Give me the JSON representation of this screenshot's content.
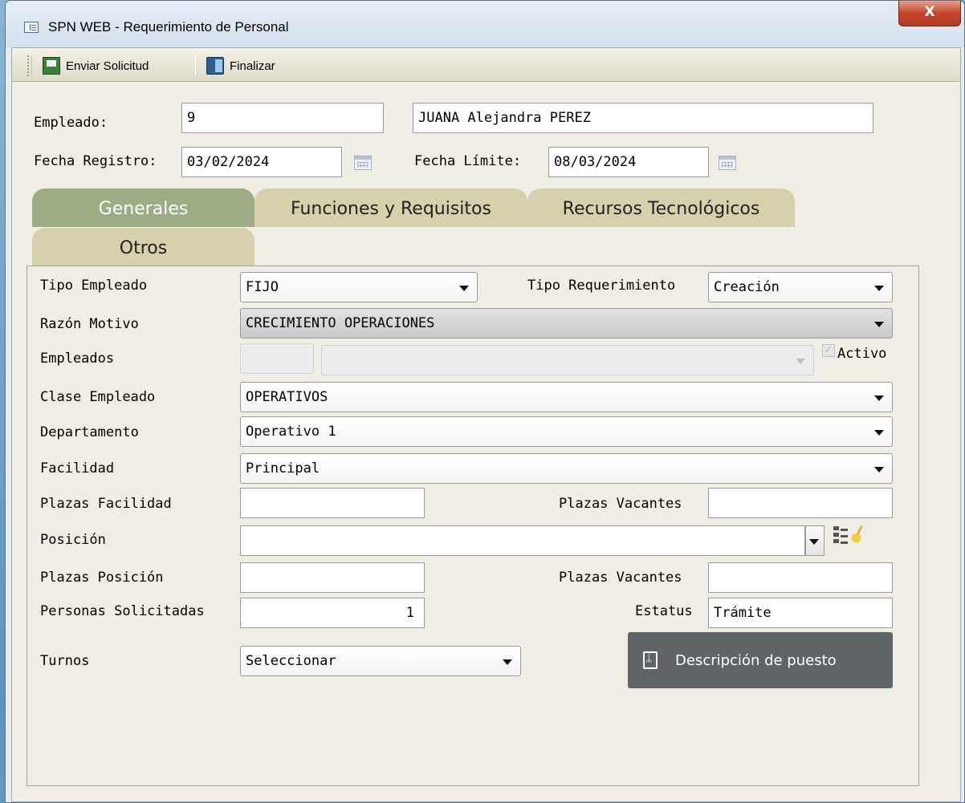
{
  "window": {
    "title": "SPN WEB - Requerimiento de Personal",
    "close_glyph": "X"
  },
  "toolbar": {
    "send_label": "Enviar Solicitud",
    "finish_label": "Finalizar"
  },
  "header": {
    "empleado_label": "Empleado:",
    "empleado_id": "9",
    "empleado_name": "JUANA Alejandra PEREZ",
    "fecha_registro_label": "Fecha Registro:",
    "fecha_registro": "03/02/2024",
    "fecha_limite_label": "Fecha Límite:",
    "fecha_limite": "08/03/2024"
  },
  "tabs": [
    {
      "label": "Generales",
      "active": true
    },
    {
      "label": "Funciones y Requisitos",
      "active": false
    },
    {
      "label": "Recursos Tecnológicos",
      "active": false
    },
    {
      "label": "Otros",
      "active": false
    }
  ],
  "form": {
    "tipo_empleado_label": "Tipo Empleado",
    "tipo_empleado": "FIJO",
    "tipo_requerimiento_label": "Tipo Requerimiento",
    "tipo_requerimiento": "Creación",
    "razon_motivo_label": "Razón Motivo",
    "razon_motivo": "CRECIMIENTO OPERACIONES",
    "empleados_label": "Empleados",
    "activo_label": "Activo",
    "activo_checked": true,
    "clase_empleado_label": "Clase Empleado",
    "clase_empleado": "OPERATIVOS",
    "departamento_label": "Departamento",
    "departamento": "Operativo 1",
    "facilidad_label": "Facilidad",
    "facilidad": "Principal",
    "plazas_facilidad_label": "Plazas Facilidad",
    "plazas_facilidad": "",
    "plazas_vacantes_label": "Plazas Vacantes",
    "plazas_vacantes_1": "",
    "posicion_label": "Posición",
    "posicion": "",
    "plazas_posicion_label": "Plazas Posición",
    "plazas_posicion": "",
    "plazas_vacantes_2": "",
    "personas_solicitadas_label": "Personas Solicitadas",
    "personas_solicitadas": "1",
    "estatus_label": "Estatus",
    "estatus": "Trámite",
    "turnos_label": "Turnos",
    "turnos": "Seleccionar",
    "descripcion_button": "Descripción de puesto"
  },
  "icons": {
    "app": "window-form-icon",
    "send": "save-send-icon",
    "finish": "exit-door-icon",
    "calendar": "calendar-icon",
    "tree": "tree-view-icon",
    "broom": "broom-clear-icon",
    "pdf": "pdf-icon"
  }
}
